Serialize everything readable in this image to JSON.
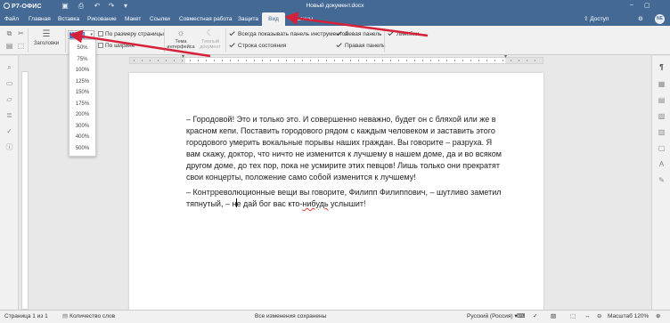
{
  "app": {
    "logo_text": "Р7-ОФИС",
    "document_title": "Новый документ.docx"
  },
  "tabs": [
    {
      "label": "Файл"
    },
    {
      "label": "Главная"
    },
    {
      "label": "Вставка"
    },
    {
      "label": "Рисование"
    },
    {
      "label": "Макет"
    },
    {
      "label": "Ссылки"
    },
    {
      "label": "Совместная работа"
    },
    {
      "label": "Защита"
    },
    {
      "label": "Вид"
    },
    {
      "label": "Плагины"
    }
  ],
  "active_tab": "Вид",
  "header_right": {
    "access_label": "Доступ",
    "avatar_initials": "NE"
  },
  "toolbar": {
    "headings_label": "Заголовки",
    "zoom_value": "120%",
    "fit_page_label": "По размеру страницы",
    "fit_width_label": "По ширине",
    "interface_theme_label": "Тема интерфейса",
    "dark_document_label": "Темный документ",
    "checkboxes": [
      {
        "label": "Всегда показывать панель инструментов",
        "checked": true
      },
      {
        "label": "Строка состояния",
        "checked": true
      },
      {
        "label": "Левая панель",
        "checked": true
      },
      {
        "label": "Правая панель",
        "checked": true
      },
      {
        "label": "Линейки",
        "checked": true
      }
    ]
  },
  "zoom_menu": {
    "options": [
      "50%",
      "75%",
      "100%",
      "125%",
      "150%",
      "175%",
      "200%",
      "300%",
      "400%",
      "500%"
    ]
  },
  "document": {
    "paragraph1": "– Городовой! Это и только это. И совершенно неважно, будет он с бляхой или же в красном кепи. Поставить городового рядом с каждым человеком и заставить этого городового умерить вокальные порывы наших граждан. Вы говорите – разруха. Я вам скажу, доктор, что ничто не изменится к лучшему в нашем доме, да и во всяком другом доме, до тех пор, пока не усмирите этих певцов! Лишь только они прекратят свои концерты, положение само собой изменится к лучшему!",
    "paragraph2_before": "– Контрреволюционные вещи вы говорите, Филипп Филиппович, – шутливо заметил тяпнутый, – н",
    "paragraph2_middle": "е дай бог вас кто-",
    "paragraph2_misspelled": "нибудь",
    "paragraph2_after": " услышит!"
  },
  "statusbar": {
    "page_label": "Страница 1 из 1",
    "word_count_label": "Количество слов",
    "save_status": "Все изменения сохранены",
    "language": "Русский (Россия)",
    "zoom_label": "Масштаб 120%"
  },
  "colors": {
    "brand": "#446995",
    "annotation_arrow": "#d6213a",
    "selection": "#3d7ae0"
  }
}
